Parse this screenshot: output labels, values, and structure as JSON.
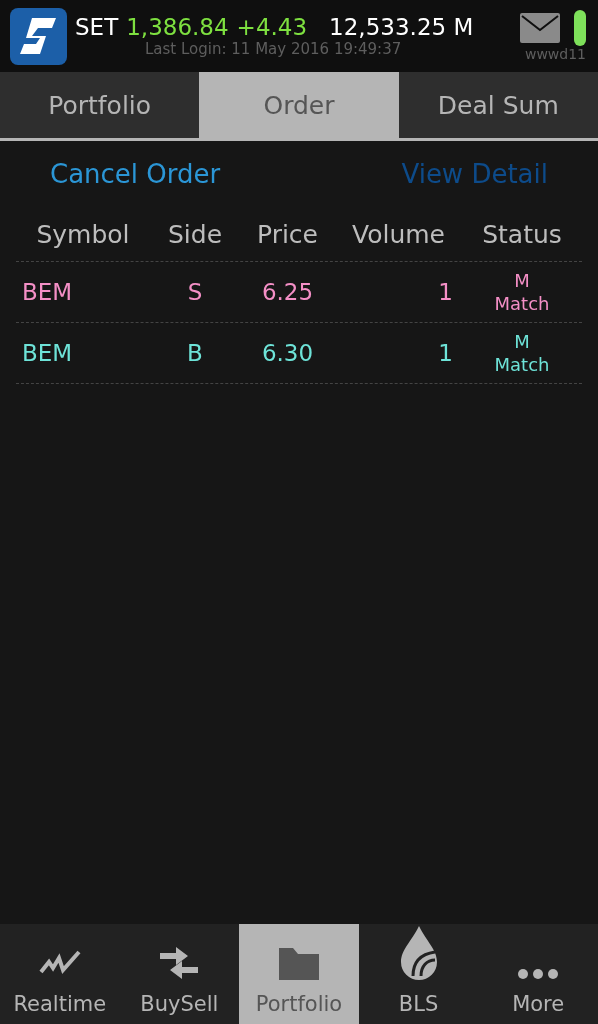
{
  "header": {
    "index_name": "SET",
    "index_value": "1,386.84",
    "index_change": "+4.43",
    "turnover": "12,533.25 M",
    "last_login": "Last Login: 11 May 2016 19:49:37",
    "user": "wwwd11"
  },
  "tabs": [
    {
      "label": "Portfolio",
      "selected": false
    },
    {
      "label": "Order",
      "selected": true
    },
    {
      "label": "Deal Sum",
      "selected": false
    }
  ],
  "actions": [
    {
      "label": "Cancel Order",
      "disabled": false
    },
    {
      "label": "View Detail",
      "disabled": true
    }
  ],
  "table": {
    "columns": [
      "Symbol",
      "Side",
      "Price",
      "Volume",
      "Status"
    ],
    "rows": [
      {
        "symbol": "BEM",
        "side": "S",
        "price": "6.25",
        "volume": "1",
        "status_code": "M",
        "status": "Match",
        "color": "#f48fc6"
      },
      {
        "symbol": "BEM",
        "side": "B",
        "price": "6.30",
        "volume": "1",
        "status_code": "M",
        "status": "Match",
        "color": "#6ee3d8"
      }
    ]
  },
  "bottom_nav": [
    {
      "label": "Realtime",
      "kind": "chart",
      "selected": false
    },
    {
      "label": "BuySell",
      "kind": "arrows",
      "selected": false
    },
    {
      "label": "Portfolio",
      "kind": "folder",
      "selected": true
    },
    {
      "label": "BLS",
      "kind": "drop",
      "selected": false
    },
    {
      "label": "More",
      "kind": "dots",
      "selected": false
    }
  ]
}
